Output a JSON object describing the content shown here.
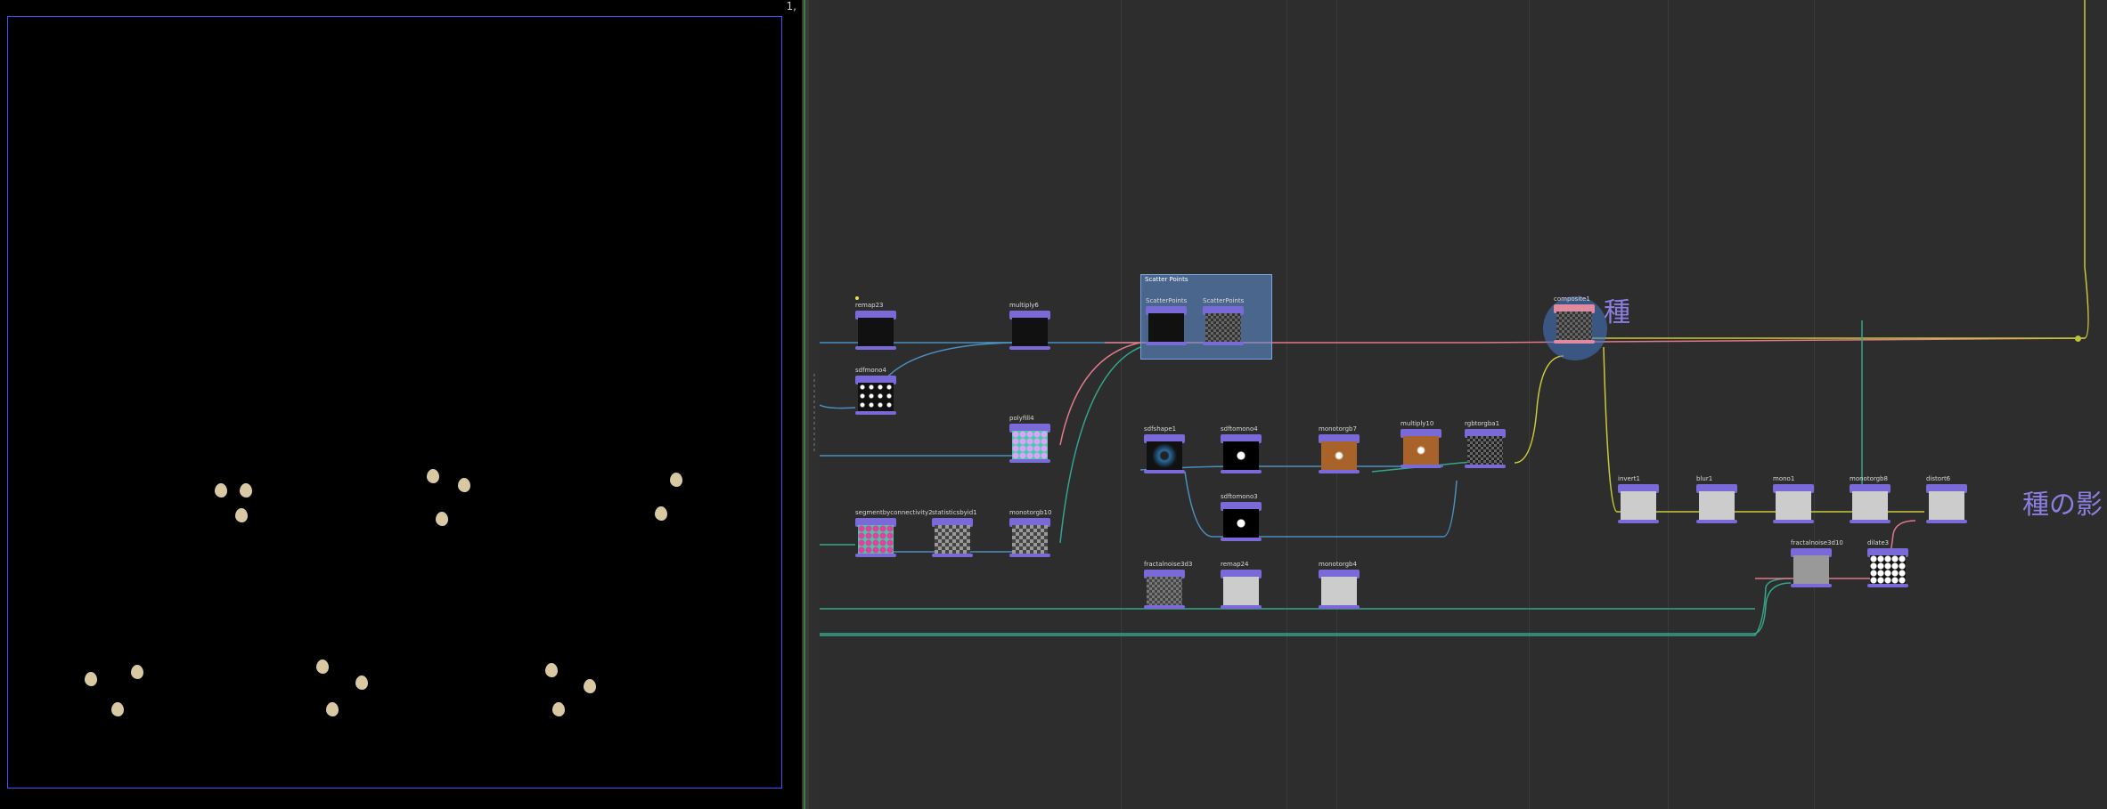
{
  "viewer": {
    "corner_label": "1,"
  },
  "network": {
    "scatter_box_title": "Scatter Points",
    "label_seed": "種",
    "label_shadow": "種の影",
    "nodes": [
      {
        "id": "remap23",
        "label": "remap23",
        "thumb": "dots"
      },
      {
        "id": "sdfmono4",
        "label": "sdfmono4",
        "thumb": "rings"
      },
      {
        "id": "multiply6",
        "label": "multiply6",
        "thumb": "dark"
      },
      {
        "id": "polyfill4",
        "label": "polyfill4",
        "thumb": "hex-color"
      },
      {
        "id": "segmentbyconnectivity2",
        "label": "segmentbyconnectivity2",
        "thumb": "hex-color"
      },
      {
        "id": "statisticsbyid1",
        "label": "statisticsbyid1",
        "thumb": "check"
      },
      {
        "id": "monotorgb10",
        "label": "monotorgb10",
        "thumb": "check"
      },
      {
        "id": "scatterpoints1",
        "label": "ScatterPoints",
        "thumb": "dark"
      },
      {
        "id": "scatterpoints2",
        "label": "ScatterPoints",
        "thumb": "check"
      },
      {
        "id": "sdfshape1",
        "label": "sdfshape1",
        "thumb": "blue-circle"
      },
      {
        "id": "sdftomono4",
        "label": "sdftomono4",
        "thumb": "white-dot"
      },
      {
        "id": "monotorgb7",
        "label": "monotorgb7",
        "thumb": "orange"
      },
      {
        "id": "multiply10",
        "label": "multiply10",
        "thumb": "orange"
      },
      {
        "id": "rgbtorgba1",
        "label": "rgbtorgba1",
        "thumb": "check"
      },
      {
        "id": "sdftomono3",
        "label": "sdftomono3",
        "thumb": "white-dot"
      },
      {
        "id": "fractalnoise3d3",
        "label": "fractalnoise3d3",
        "thumb": "check"
      },
      {
        "id": "remap24",
        "label": "remap24",
        "thumb": "gray"
      },
      {
        "id": "monotorgb4",
        "label": "monotorgb4",
        "thumb": "gray"
      },
      {
        "id": "composite1",
        "label": "composite1",
        "thumb": "check"
      },
      {
        "id": "invert1",
        "label": "invert1",
        "thumb": "gray"
      },
      {
        "id": "blur1",
        "label": "blur1",
        "thumb": "gray"
      },
      {
        "id": "mono1",
        "label": "mono1",
        "thumb": "gray"
      },
      {
        "id": "monotorgb8",
        "label": "monotorgb8",
        "thumb": "gray"
      },
      {
        "id": "distort6",
        "label": "distort6",
        "thumb": "gray"
      },
      {
        "id": "fractalnoise3d10",
        "label": "fractalnoise3d10",
        "thumb": "gray"
      },
      {
        "id": "dilate3",
        "label": "dilate3",
        "thumb": "white-blob"
      }
    ]
  },
  "colors": {
    "accent": "#7a6ad8",
    "wire_green": "#33a58a",
    "wire_yellow": "#c9c93c",
    "wire_pink": "#e07a8a"
  }
}
